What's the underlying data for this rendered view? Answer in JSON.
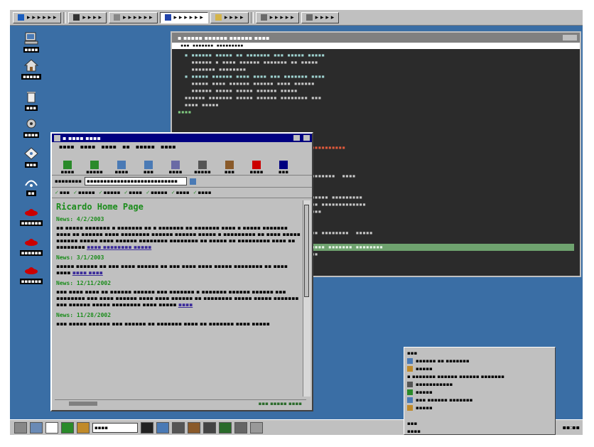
{
  "colors": {
    "desktop": "#3a6ea5",
    "terminal_bg": "#2b2b2b",
    "browser_title": "#000080",
    "link_purple": "#3a2a9a",
    "heading_green": "#1a8c1a"
  },
  "top_taskbar": {
    "tasks": [
      {
        "label": "▸ ▸ ▸ ▸ ▸ ▸",
        "icon": "start-icon",
        "active": false
      },
      {
        "label": "▸ ▸ ▸ ▸",
        "icon": "terminal-icon",
        "active": false
      },
      {
        "label": "▸ ▸ ▸ ▸ ▸ ▸",
        "icon": "window-icon",
        "active": false
      },
      {
        "label": "▸ ▸ ▸ ▸ ▸ ▸",
        "icon": "browser-icon",
        "active": true
      },
      {
        "label": "▸ ▸ ▸ ▸",
        "icon": "folder-icon",
        "active": false
      },
      {
        "label": "▸ ▸ ▸ ▸ ▸",
        "icon": "app-icon",
        "active": false
      },
      {
        "label": "▸ ▸ ▸ ▸",
        "icon": "app-icon",
        "active": false
      }
    ]
  },
  "desktop_icons": [
    {
      "name": "computer-icon",
      "label": "▪▪▪▪"
    },
    {
      "name": "home-icon",
      "label": "▪▪▪▪▪"
    },
    {
      "name": "trash-icon",
      "label": "▪▪▪"
    },
    {
      "name": "settings-icon",
      "label": "▪▪▪▪"
    },
    {
      "name": "disk-icon",
      "label": "▪▪▪"
    },
    {
      "name": "network-icon",
      "label": "▪▪"
    },
    {
      "name": "redhat-icon",
      "label": "▪▪▪▪▪▪"
    },
    {
      "name": "redhat-icon",
      "label": "▪▪▪▪▪▪"
    },
    {
      "name": "redhat-icon",
      "label": "▪▪▪▪▪▪"
    }
  ],
  "terminal": {
    "title": "▪ ▪▪▪▪▪ ▪▪▪▪▪▪ ▪▪▪▪▪▪ ▪▪▪▪",
    "subtitle": "▪▪▪ ▪▪▪▪▪▪▪ ▪▪▪▪▪▪▪▪▪",
    "lines": [
      {
        "text": "  ▪ ▪▪▪▪▪▪ ▪▪▪▪▪ ▪▪ ▪▪▪▪▪▪▪ ▪▪▪ ▪▪▪▪▪ ▪▪▪▪▪",
        "style": "cyan"
      },
      {
        "text": "    ▪▪▪▪▪▪ ▪ ▪▪▪▪ ▪▪▪▪▪▪ ▪▪▪▪▪▪▪ ▪▪ ▪▪▪▪▪",
        "style": ""
      },
      {
        "text": "    ▪▪▪▪▪▪▪ ▪▪▪▪▪▪▪▪",
        "style": ""
      },
      {
        "text": "  ▪ ▪▪▪▪▪ ▪▪▪▪▪▪ ▪▪▪▪ ▪▪▪▪ ▪▪▪ ▪▪▪▪▪▪▪ ▪▪▪▪",
        "style": "cyan"
      },
      {
        "text": "    ▪▪▪▪▪ ▪▪▪▪ ▪▪▪▪▪▪ ▪▪▪▪▪▪ ▪▪▪▪ ▪▪▪▪▪▪",
        "style": ""
      },
      {
        "text": "    ▪▪▪▪▪▪ ▪▪▪▪▪ ▪▪▪▪▪ ▪▪▪▪▪▪ ▪▪▪▪▪",
        "style": ""
      },
      {
        "text": "  ▪▪▪▪▪▪ ▪▪▪▪▪▪▪ ▪▪▪▪▪ ▪▪▪▪▪▪ ▪▪▪▪▪▪▪▪ ▪▪▪",
        "style": ""
      },
      {
        "text": "  ▪▪▪▪ ▪▪▪▪▪",
        "style": ""
      },
      {
        "text": "▪▪▪▪",
        "style": "green"
      },
      {
        "text": "",
        "style": ""
      },
      {
        "text": "",
        "style": ""
      },
      {
        "text": "",
        "style": ""
      },
      {
        "text": "",
        "style": ""
      },
      {
        "text": "                              ▪▪▪▪▪▪▪▪▪▪▪▪▪▪▪▪▪▪▪",
        "style": "red"
      },
      {
        "text": "                              ▪▪▪▪▪",
        "style": ""
      },
      {
        "text": "",
        "style": ""
      },
      {
        "text": "",
        "style": ""
      },
      {
        "text": "                              ▪▪▪▪▪▪  ▪▪▪▪▪▪▪▪  ▪▪▪▪",
        "style": ""
      },
      {
        "text": "",
        "style": ""
      },
      {
        "text": "",
        "style": ""
      },
      {
        "text": "                              ▪▪▪▪▪ ▪▪ ▪▪▪▪▪ ▪▪▪▪▪▪▪▪▪",
        "style": ""
      },
      {
        "text": "                              ▪▪▪▪▪ ▪▪▪▪▪ ▪▪▪▪▪▪▪▪▪▪▪▪▪",
        "style": ""
      },
      {
        "text": "                              ▪▪▪▪▪▪ ▪▪▪▪▪",
        "style": ""
      },
      {
        "text": "",
        "style": ""
      },
      {
        "text": "",
        "style": ""
      },
      {
        "text": "                              ▪▪▪ ▪▪▪▪▪▪▪ ▪▪▪▪▪▪▪▪  ▪▪▪▪▪",
        "style": ""
      },
      {
        "text": "",
        "style": ""
      },
      {
        "text": "                              ▪▪▪▪▪▪ ▪▪▪▪▪▪ ▪▪▪▪▪▪▪ ▪▪▪▪▪▪▪▪",
        "style": "bar"
      },
      {
        "text": "                              ▪▪▪▪▪▪▪▪▪▪▪",
        "style": ""
      }
    ]
  },
  "browser": {
    "title": "▪ ▪▪▪▪ ▪▪▪▪",
    "menu": [
      "▪▪▪▪",
      "▪▪▪▪",
      "▪▪▪▪",
      "▪▪",
      "▪▪▪▪▪",
      "▪▪▪▪"
    ],
    "toolbar": [
      {
        "label": "▪▪▪▪",
        "icon": "back-icon"
      },
      {
        "label": "▪▪▪▪▪",
        "icon": "forward-icon"
      },
      {
        "label": "▪▪▪▪",
        "icon": "reload-icon"
      },
      {
        "label": "▪▪▪",
        "icon": "home-icon"
      },
      {
        "label": "▪▪▪▪",
        "icon": "search-icon"
      },
      {
        "label": "▪▪▪▪▪",
        "icon": "print-icon"
      },
      {
        "label": "▪▪▪",
        "icon": "security-icon"
      },
      {
        "label": "▪▪▪▪",
        "icon": "stop-icon"
      },
      {
        "label": "▪▪▪",
        "icon": "netscape-icon"
      }
    ],
    "location_label": "▪▪▪▪▪▪▪▪",
    "location_value": "▪▪▪▪▪▪▪▪▪▪▪▪▪▪▪▪▪▪▪▪▪▪▪▪▪▪▪",
    "bookmarks": [
      "▪▪▪",
      "▪▪▪▪▪",
      "▪▪▪▪▪",
      "▪▪▪▪",
      "▪▪▪▪▪",
      "▪▪▪▪",
      "▪▪▪▪"
    ],
    "page": {
      "heading": "Ricardo Home Page",
      "news": [
        {
          "date": "News: 4/2/2003",
          "body": "▪▪ ▪▪▪▪▪ ▪▪▪▪▪▪▪ ▪ ▪▪▪▪▪▪▪ ▪▪ ▪ ▪▪▪▪▪▪▪ ▪▪ ▪▪▪▪▪▪▪ ▪▪▪▪ ▪ ▪▪▪▪▪ ▪▪▪▪▪▪▪ ▪▪▪▪ ▪▪ ▪▪▪▪▪▪ ▪▪▪▪ ▪▪▪▪▪▪▪▪ ▪▪▪▪▪▪ ▪▪▪▪▪▪ ▪▪▪▪▪ ▪ ▪▪▪▪▪▪▪▪▪ ▪▪ ▪▪▪▪ ▪▪▪▪▪ ▪▪▪▪▪▪ ▪▪▪▪▪ ▪▪▪▪ ▪▪▪▪▪▪ ▪▪▪▪▪▪▪▪ ▪▪▪▪▪▪▪▪ ▪▪ ▪▪▪▪▪ ▪▪ ▪▪▪▪▪▪▪▪▪ ▪▪▪▪ ▪▪ ▪▪▪▪▪▪▪▪",
          "link": "▪▪▪▪ ▪▪▪▪▪▪▪▪ ▪▪▪▪▪"
        },
        {
          "date": "News: 3/1/2003",
          "body": "▪▪▪▪▪ ▪▪▪▪▪▪ ▪▪ ▪▪▪ ▪▪▪▪ ▪▪▪▪▪▪ ▪▪ ▪▪▪ ▪▪▪▪ ▪▪▪▪ ▪▪▪▪▪ ▪▪▪▪▪▪▪▪ ▪▪ ▪▪▪▪ ▪▪▪▪",
          "link": "▪▪▪▪ ▪▪▪▪"
        },
        {
          "date": "News: 12/11/2002",
          "body": "▪▪▪ ▪▪▪▪ ▪▪▪▪ ▪▪ ▪▪▪▪▪▪ ▪▪▪▪▪▪ ▪▪▪ ▪▪▪▪▪▪▪ ▪ ▪▪▪▪▪▪▪ ▪▪▪▪▪▪ ▪▪▪▪▪▪ ▪▪▪ ▪▪▪▪▪▪▪▪ ▪▪▪ ▪▪▪▪ ▪▪▪▪▪▪ ▪▪▪▪ ▪▪▪▪ ▪▪▪▪▪▪ ▪▪ ▪▪▪▪▪▪▪▪ ▪▪▪▪▪ ▪▪▪▪▪ ▪▪▪▪▪▪▪ ▪▪▪ ▪▪▪▪▪▪ ▪▪▪▪▪ ▪▪▪▪▪▪▪▪ ▪▪▪▪ ▪▪▪▪▪",
          "link": "▪▪▪▪"
        },
        {
          "date": "News: 11/28/2002",
          "body": "▪▪▪ ▪▪▪▪▪ ▪▪▪▪▪▪ ▪▪▪ ▪▪▪▪▪▪ ▪▪ ▪▪▪▪▪▪▪ ▪▪▪▪ ▪▪ ▪▪▪▪▪▪▪ ▪▪▪▪ ▪▪▪▪▪",
          "link": ""
        }
      ]
    },
    "status_text": "▪▪▪ ▪▪▪▪▪ ▪▪▪▪"
  },
  "bottom_taskbar": {
    "field_value": "▪▪▪▪",
    "icons": [
      "settings-icon",
      "tools-icon",
      "text-icon",
      "monitor-icon",
      "palette-icon",
      "terminal-icon",
      "edit-icon",
      "files-icon",
      "network-icon",
      "printer-icon",
      "gnome-icon",
      "calculator-icon",
      "help-icon"
    ],
    "clock": "▪▪:▪▪"
  },
  "popup_menu": {
    "items": [
      {
        "label": "▪▪▪",
        "icon": "none"
      },
      {
        "label": "▪▪▪▪▪▪ ▪▪ ▪▪▪▪▪▪▪",
        "icon": "app-icon"
      },
      {
        "label": "▪▪▪▪▪",
        "icon": "app-icon"
      },
      {
        "label": "▪ ▪▪▪▪▪▪▪ ▪▪▪▪▪▪ ▪▪▪▪▪▪ ▪▪▪▪▪▪▪",
        "icon": "none"
      },
      {
        "label": "▪▪▪▪▪▪▪▪▪▪▪",
        "icon": "app-icon"
      },
      {
        "label": "▪▪▪▪▪",
        "icon": "app-icon"
      },
      {
        "label": "▪▪▪ ▪▪▪▪▪▪ ▪▪▪▪▪▪▪",
        "icon": "app-icon"
      },
      {
        "label": "▪▪▪▪▪",
        "icon": "app-icon"
      },
      {
        "label": "",
        "icon": "none"
      },
      {
        "label": "▪▪▪",
        "icon": "none"
      },
      {
        "label": "▪▪▪▪",
        "icon": "none"
      }
    ]
  }
}
